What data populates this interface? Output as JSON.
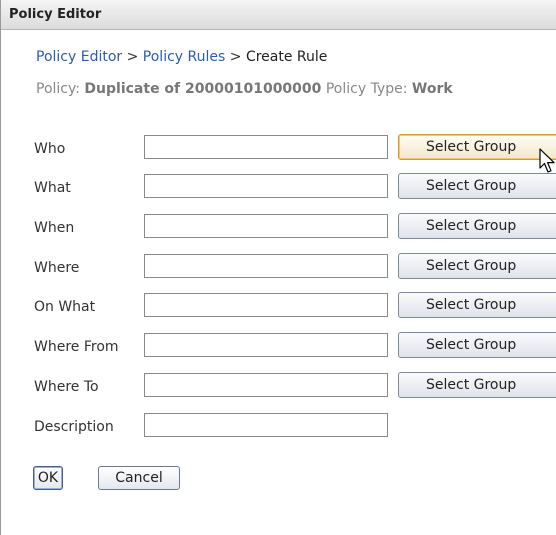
{
  "window": {
    "title": "Policy Editor"
  },
  "breadcrumb": {
    "items": [
      "Policy Editor",
      "Policy Rules",
      "Create Rule"
    ],
    "separator": ">"
  },
  "policy_info": {
    "policy_label": "Policy:",
    "policy_name": "Duplicate of 20000101000000",
    "type_label": "Policy Type:",
    "type_value": "Work"
  },
  "form": {
    "rows": [
      {
        "label": "Who",
        "value": "",
        "button": "Select Group"
      },
      {
        "label": "What",
        "value": "",
        "button": "Select Group"
      },
      {
        "label": "When",
        "value": "",
        "button": "Select Group"
      },
      {
        "label": "Where",
        "value": "",
        "button": "Select Group"
      },
      {
        "label": "On What",
        "value": "",
        "button": "Select Group"
      },
      {
        "label": "Where From",
        "value": "",
        "button": "Select Group"
      },
      {
        "label": "Where To",
        "value": "",
        "button": "Select Group"
      }
    ],
    "description": {
      "label": "Description",
      "value": ""
    }
  },
  "actions": {
    "ok": "OK",
    "cancel": "Cancel"
  },
  "colors": {
    "link": "#2a5db0",
    "focus_border": "#d59a2c"
  }
}
